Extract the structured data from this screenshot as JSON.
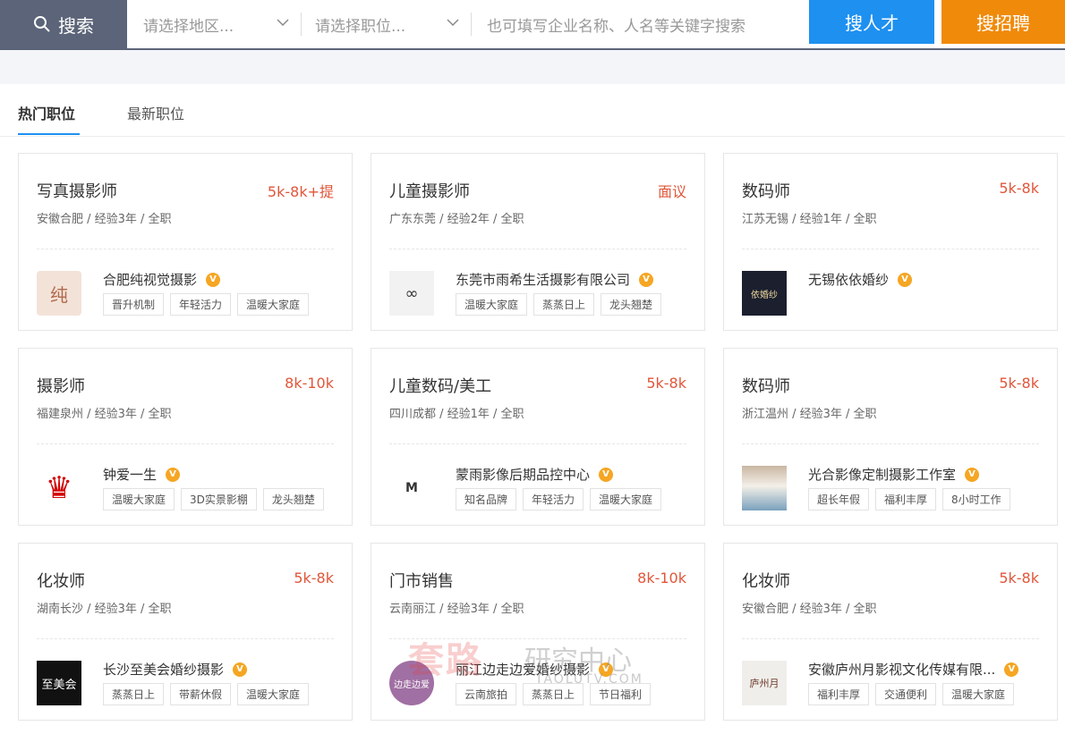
{
  "search": {
    "label": "搜索",
    "region_placeholder": "请选择地区...",
    "position_placeholder": "请选择职位...",
    "keyword_placeholder": "也可填写企业名称、人名等关键字搜索",
    "btn_talent": "搜人才",
    "btn_jobs": "搜招聘"
  },
  "tabs": [
    {
      "label": "热门职位",
      "active": true
    },
    {
      "label": "最新职位",
      "active": false
    }
  ],
  "cards": [
    {
      "title": "写真摄影师",
      "salary": "5k-8k+提",
      "meta": "安徽合肥 / 经验3年 / 全职",
      "company": "合肥纯视觉摄影",
      "logo": "纯",
      "tags": [
        "晋升机制",
        "年轻活力",
        "温暖大家庭"
      ]
    },
    {
      "title": "儿童摄影师",
      "salary": "面议",
      "meta": "广东东莞 / 经验2年 / 全职",
      "company": "东莞市雨希生活摄影有限公司",
      "logo": "∞",
      "tags": [
        "温暖大家庭",
        "蒸蒸日上",
        "龙头翘楚"
      ]
    },
    {
      "title": "数码师",
      "salary": "5k-8k",
      "meta": "江苏无锡 / 经验1年 / 全职",
      "company": "无锡依依婚纱",
      "logo": "依婚纱",
      "tags": []
    },
    {
      "title": "摄影师",
      "salary": "8k-10k",
      "meta": "福建泉州 / 经验3年 / 全职",
      "company": "钟爱一生",
      "logo": "♛",
      "tags": [
        "温暖大家庭",
        "3D实景影棚",
        "龙头翘楚"
      ]
    },
    {
      "title": "儿童数码/美工",
      "salary": "5k-8k",
      "meta": "四川成都 / 经验1年 / 全职",
      "company": "蒙雨影像后期品控中心",
      "logo": "M",
      "tags": [
        "知名品牌",
        "年轻活力",
        "温暖大家庭"
      ]
    },
    {
      "title": "数码师",
      "salary": "5k-8k",
      "meta": "浙江温州 / 经验3年 / 全职",
      "company": "光合影像定制摄影工作室",
      "logo": "",
      "tags": [
        "超长年假",
        "福利丰厚",
        "8小时工作"
      ]
    },
    {
      "title": "化妆师",
      "salary": "5k-8k",
      "meta": "湖南长沙 / 经验3年 / 全职",
      "company": "长沙至美会婚纱摄影",
      "logo": "至美会",
      "tags": [
        "蒸蒸日上",
        "带薪休假",
        "温暖大家庭"
      ]
    },
    {
      "title": "门市销售",
      "salary": "8k-10k",
      "meta": "云南丽江 / 经验3年 / 全职",
      "company": "丽江边走边爱婚纱摄影",
      "logo": "边走边爱",
      "tags": [
        "云南旅拍",
        "蒸蒸日上",
        "节日福利"
      ]
    },
    {
      "title": "化妆师",
      "salary": "5k-8k",
      "meta": "安徽合肥 / 经验3年 / 全职",
      "company": "安徽庐州月影视文化传媒有限...",
      "logo": "庐州月",
      "tags": [
        "福利丰厚",
        "交通便利",
        "温暖大家庭"
      ]
    }
  ],
  "watermark": {
    "main": "套路",
    "side": "研究中心",
    "url": "TAOLUTV.COM"
  },
  "colors": {
    "accent_blue": "#1e90f0",
    "accent_orange": "#f08a0a",
    "salary_red": "#e0563a",
    "search_gray": "#5b6478"
  },
  "icons": {
    "search": "search-icon",
    "dropdown": "chevron-down-icon",
    "verified": "verified-v-icon"
  }
}
